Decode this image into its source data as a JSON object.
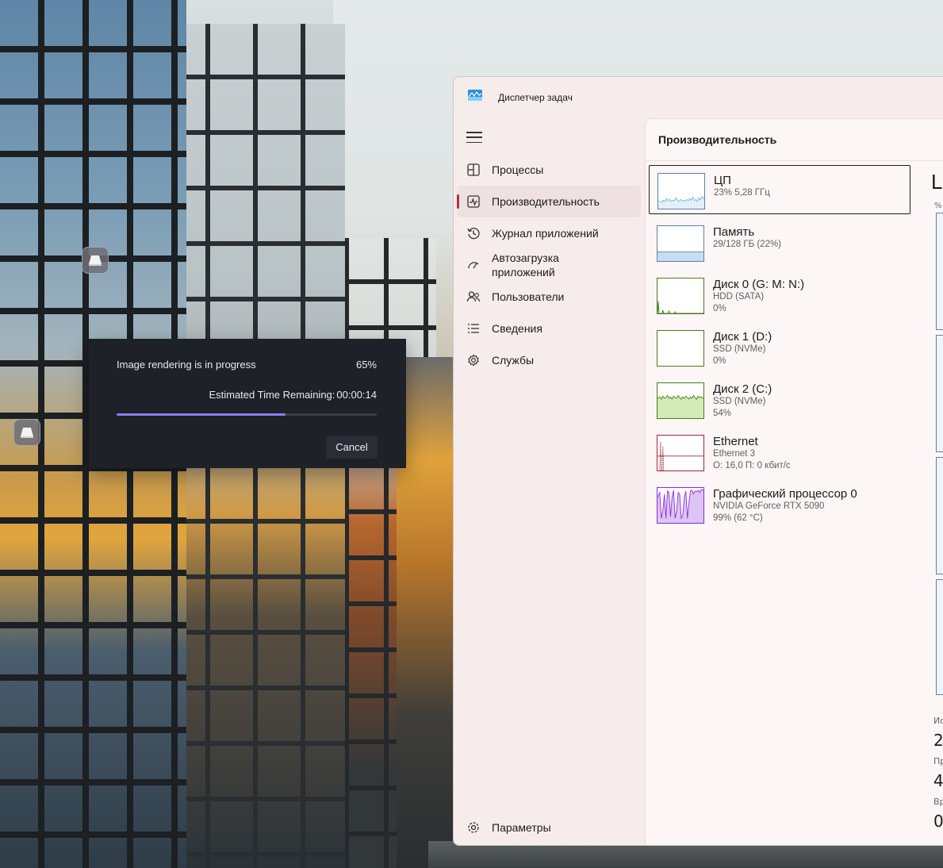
{
  "render_dialog": {
    "title": "Image rendering is in progress",
    "percent_text": "65%",
    "progress": 0.65,
    "eta_label": "Estimated Time Remaining:",
    "eta_value": "00:00:14",
    "cancel_label": "Cancel",
    "accent_color": "#8b7cf6"
  },
  "task_manager": {
    "title": "Диспетчер задач",
    "nav": [
      {
        "label": "Процессы",
        "icon": "processes-icon"
      },
      {
        "label": "Производительность",
        "icon": "performance-icon",
        "active": true
      },
      {
        "label": "Журнал приложений",
        "icon": "app-history-icon"
      },
      {
        "label": "Автозагрузка приложений",
        "icon": "startup-apps-icon"
      },
      {
        "label": "Пользователи",
        "icon": "users-icon"
      },
      {
        "label": "Сведения",
        "icon": "details-icon"
      },
      {
        "label": "Службы",
        "icon": "services-icon"
      }
    ],
    "settings_label": "Параметры",
    "section_title": "Производительность",
    "perf_items": [
      {
        "name": "ЦП",
        "sub1": "23%  5,28 ГГц",
        "sub2": "",
        "color": "#1976b8",
        "fill": "#ffffff"
      },
      {
        "name": "Память",
        "sub1": "29/128 ГБ (22%)",
        "sub2": "",
        "color": "#5a84a8",
        "fill": "#c7dcf0"
      },
      {
        "name": "Диск 0 (G: M: N:)",
        "sub1": "HDD (SATA)",
        "sub2": "0%",
        "color": "#4c7a1a",
        "fill": "#ffffff"
      },
      {
        "name": "Диск 1 (D:)",
        "sub1": "SSD (NVMe)",
        "sub2": "0%",
        "color": "#4c7a1a",
        "fill": "#ffffff"
      },
      {
        "name": "Диск 2 (C:)",
        "sub1": "SSD (NVMe)",
        "sub2": "54%",
        "color": "#4c7a1a",
        "fill": "#d3ecb7"
      },
      {
        "name": "Ethernet",
        "sub1": "Ethernet 3",
        "sub2": "О: 16,0 П: 0 кбит/с",
        "color": "#a3243c",
        "fill": "#ffffff"
      },
      {
        "name": "Графический процессор 0",
        "sub1": "NVIDIA GeForce RTX 5090",
        "sub2": "99% (62 °C)",
        "color": "#8a2be2",
        "fill": "#dcc4f3"
      }
    ],
    "right_panel": {
      "heading_fragment": "L",
      "axis_fragment": "%",
      "stats": [
        {
          "label": "Ис",
          "value": "2"
        },
        {
          "label": "Пр",
          "value": "4"
        },
        {
          "label": "Вр",
          "value": "0"
        }
      ]
    }
  }
}
